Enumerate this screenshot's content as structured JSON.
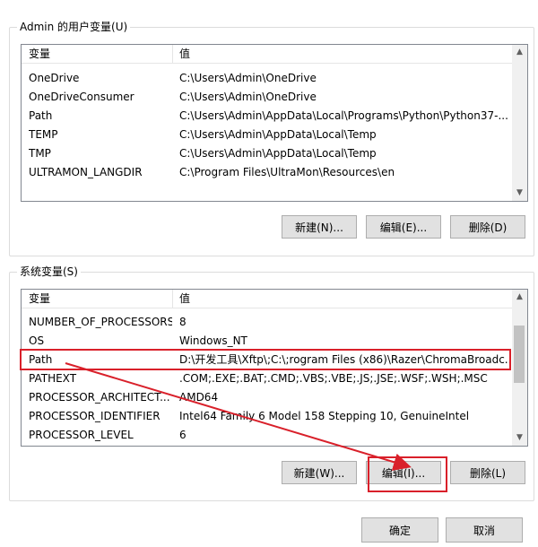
{
  "user_vars": {
    "title": "Admin 的用户变量(U)",
    "columns": [
      "变量",
      "值"
    ],
    "rows": [
      {
        "name": "OneDrive",
        "value": "C:\\Users\\Admin\\OneDrive"
      },
      {
        "name": "OneDriveConsumer",
        "value": "C:\\Users\\Admin\\OneDrive"
      },
      {
        "name": "Path",
        "value": "C:\\Users\\Admin\\AppData\\Local\\Programs\\Python\\Python37-..."
      },
      {
        "name": "TEMP",
        "value": "C:\\Users\\Admin\\AppData\\Local\\Temp"
      },
      {
        "name": "TMP",
        "value": "C:\\Users\\Admin\\AppData\\Local\\Temp"
      },
      {
        "name": "ULTRAMON_LANGDIR",
        "value": "C:\\Program Files\\UltraMon\\Resources\\en"
      }
    ],
    "buttons": {
      "new": "新建(N)...",
      "edit": "编辑(E)...",
      "delete": "删除(D)"
    }
  },
  "system_vars": {
    "title": "系统变量(S)",
    "columns": [
      "变量",
      "值"
    ],
    "rows": [
      {
        "name": "NUMBER_OF_PROCESSORS",
        "value": "8"
      },
      {
        "name": "OS",
        "value": "Windows_NT"
      },
      {
        "name": "Path",
        "value": "D:\\开发工具\\Xftp\\;C:\\;rogram Files (x86)\\Razer\\ChromaBroadc..."
      },
      {
        "name": "PATHEXT",
        "value": ".COM;.EXE;.BAT;.CMD;.VBS;.VBE;.JS;.JSE;.WSF;.WSH;.MSC"
      },
      {
        "name": "PROCESSOR_ARCHITECT...",
        "value": "AMD64"
      },
      {
        "name": "PROCESSOR_IDENTIFIER",
        "value": "Intel64 Family 6 Model 158 Stepping 10, GenuineIntel"
      },
      {
        "name": "PROCESSOR_LEVEL",
        "value": "6"
      }
    ],
    "buttons": {
      "new": "新建(W)...",
      "edit": "编辑(I)...",
      "delete": "删除(L)"
    }
  },
  "dialog_buttons": {
    "ok": "确定",
    "cancel": "取消"
  },
  "colors": {
    "highlight": "#d9202a",
    "list_border": "#828790",
    "button_bg": "#e1e1e1"
  },
  "icons": {
    "scroll_up": "chevron-up-icon",
    "scroll_down": "chevron-down-icon"
  }
}
